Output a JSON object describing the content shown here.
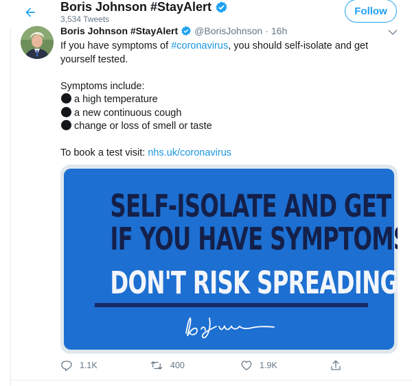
{
  "header": {
    "title": "Boris Johnson #StayAlert",
    "tweet_count": "3,534 Tweets",
    "follow_label": "Follow"
  },
  "tweet": {
    "author_name": "Boris Johnson #StayAlert",
    "handle": "@BorisJohnson",
    "separator": "·",
    "time": "16h",
    "text": {
      "line1_prefix": "If you have symptoms of ",
      "hashtag": "#coronavirus",
      "line1_suffix": ", you should self-isolate and get",
      "line2": "yourself tested.",
      "symptoms_heading": "Symptoms include:",
      "symptoms": [
        "a high temperature",
        "a new continuous cough",
        "change or loss of smell or taste"
      ],
      "book_prefix": "To book a test visit: ",
      "book_link": "nhs.uk/coronavirus"
    },
    "media": {
      "line1": "SELF-ISOLATE AND GET TESTED",
      "line2": "IF YOU HAVE SYMPTOMS",
      "line3": "DON'T RISK SPREADING THE VIRUS"
    },
    "actions": {
      "replies": "1.1K",
      "retweets": "400",
      "likes": "1.9K"
    }
  },
  "icons": {
    "back": "arrow-left-icon",
    "verified": "verified-badge-icon",
    "caret": "chevron-down-icon",
    "reply": "reply-icon",
    "retweet": "retweet-icon",
    "like": "heart-icon",
    "share": "share-icon"
  },
  "colors": {
    "accent": "#1da1f2",
    "link": "#1b95e0",
    "poster_blue": "#1d6fd1",
    "poster_navy": "#14204a",
    "muted": "#657786"
  }
}
